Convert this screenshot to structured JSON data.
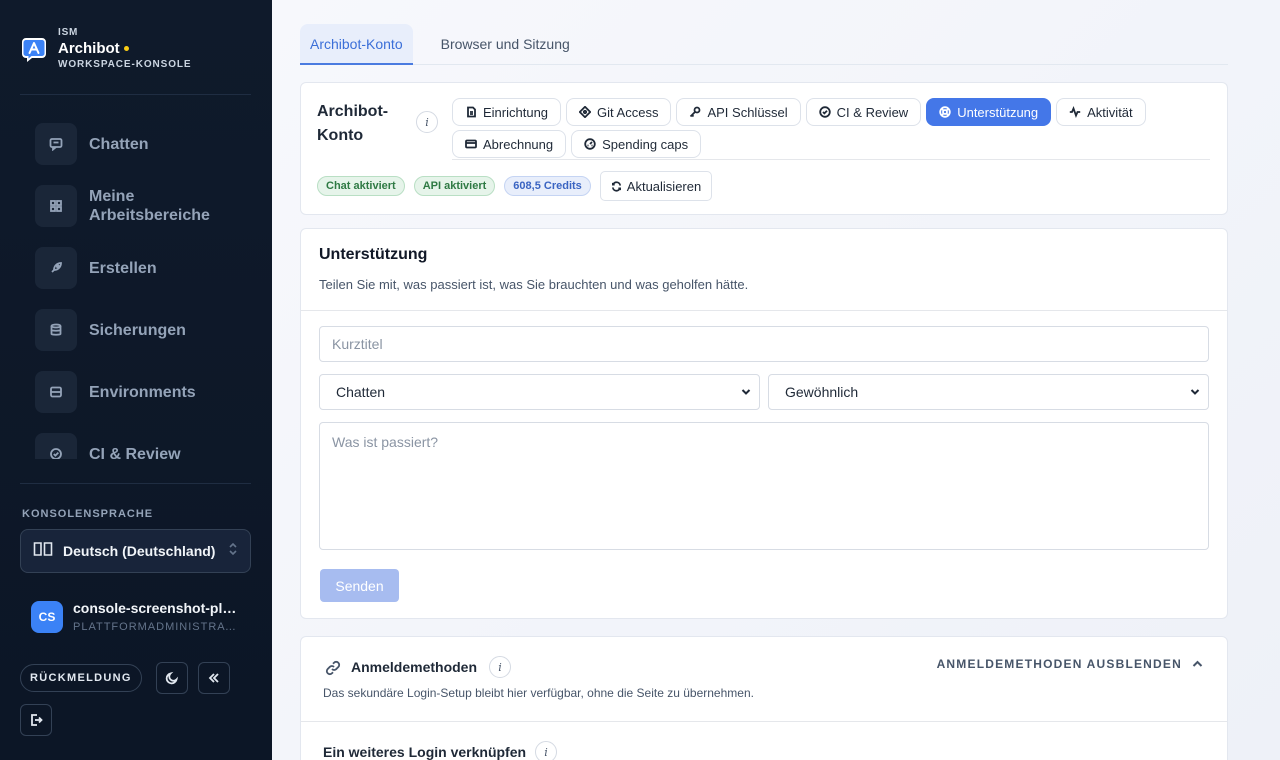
{
  "sidebar": {
    "brand": {
      "org": "ISM",
      "name": "Archibot",
      "subtitle": "WORKSPACE-KONSOLE"
    },
    "nav": [
      {
        "label": "Chatten",
        "icon": "chat-icon"
      },
      {
        "label": "Meine Arbeitsbereiche",
        "icon": "grid-icon"
      },
      {
        "label": "Erstellen",
        "icon": "rocket-icon"
      },
      {
        "label": "Sicherungen",
        "icon": "database-icon"
      },
      {
        "label": "Environments",
        "icon": "server-icon"
      },
      {
        "label": "CI & Review",
        "icon": "check-circle-icon"
      }
    ],
    "language_section_label": "KONSOLENSPRACHE",
    "language_value": "Deutsch (Deutschland)",
    "user": {
      "initials": "CS",
      "name": "console-screenshot-platform-admin",
      "role": "PLATTFORMADMINISTRATOR"
    },
    "feedback_label": "RÜCKMELDUNG"
  },
  "main": {
    "tabs": [
      {
        "label": "Archibot-Konto",
        "active": true
      },
      {
        "label": "Browser und Sitzung",
        "active": false
      }
    ],
    "account": {
      "title": "Archibot-Konto",
      "info_symbol": "i",
      "pills": [
        {
          "label": "Einrichtung",
          "icon": "setup-icon",
          "active": false
        },
        {
          "label": "Git Access",
          "icon": "git-icon",
          "active": false
        },
        {
          "label": "API Schlüssel",
          "icon": "key-icon",
          "active": false
        },
        {
          "label": "CI & Review",
          "icon": "check-circle-icon",
          "active": false
        },
        {
          "label": "Unterstützung",
          "icon": "lifebuoy-icon",
          "active": true
        },
        {
          "label": "Aktivität",
          "icon": "activity-icon",
          "active": false
        },
        {
          "label": "Abrechnung",
          "icon": "card-icon",
          "active": false
        },
        {
          "label": "Spending caps",
          "icon": "gauge-icon",
          "active": false
        }
      ],
      "badges": {
        "chat": "Chat aktiviert",
        "api": "API aktiviert",
        "credits": "608,5 Credits"
      },
      "refresh_label": "Aktualisieren"
    },
    "support": {
      "title": "Unterstützung",
      "description": "Teilen Sie mit, was passiert ist, was Sie brauchten und was geholfen hätte.",
      "title_placeholder": "Kurztitel",
      "area_value": "Chatten",
      "priority_value": "Gewöhnlich",
      "message_placeholder": "Was ist passiert?",
      "send_label": "Senden"
    },
    "login_methods": {
      "title": "Anmeldemethoden",
      "hide_label": "ANMELDEMETHODEN AUSBLENDEN",
      "description": "Das sekundäre Login-Setup bleibt hier verfügbar, ohne die Seite zu übernehmen.",
      "link_title": "Ein weiteres Login verknüpfen"
    }
  }
}
